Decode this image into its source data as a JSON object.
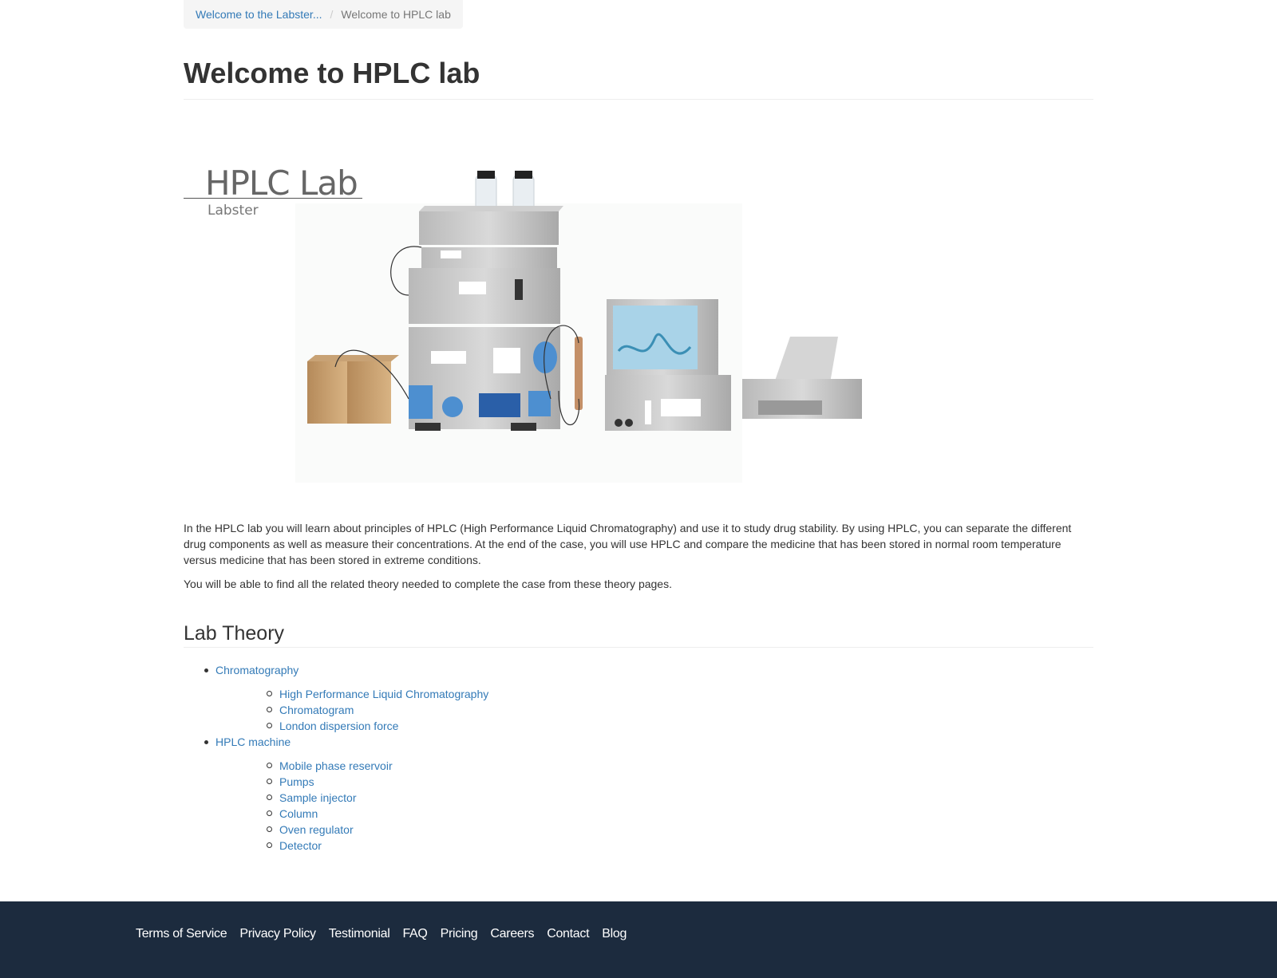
{
  "breadcrumb": {
    "items": [
      {
        "label": "Welcome to the Labster..."
      },
      {
        "label": "Welcome to HPLC lab"
      }
    ],
    "separator": "/"
  },
  "page": {
    "title": "Welcome to HPLC lab"
  },
  "hero": {
    "title": "HPLC Lab",
    "subtitle": "Labster"
  },
  "intro": {
    "paragraphs": [
      "In the HPLC lab you will learn about principles of HPLC (High Performance Liquid Chromatography) and use it to study drug stability. By using HPLC, you can separate the different drug components as well as measure their concentrations. At the end of the case, you will use HPLC and compare the medicine that has been stored in normal room temperature versus medicine that has been stored in extreme conditions.",
      "You will be able to find all the related theory needed to complete the case from these theory pages."
    ]
  },
  "theory": {
    "title": "Lab Theory",
    "items": [
      {
        "label": "Chromatography",
        "children": [
          {
            "label": "High Performance Liquid Chromatography"
          },
          {
            "label": "Chromatogram"
          },
          {
            "label": "London dispersion force"
          }
        ]
      },
      {
        "label": "HPLC machine",
        "children": [
          {
            "label": "Mobile phase reservoir"
          },
          {
            "label": "Pumps"
          },
          {
            "label": "Sample injector"
          },
          {
            "label": "Column"
          },
          {
            "label": "Oven regulator"
          },
          {
            "label": "Detector"
          }
        ]
      }
    ]
  },
  "footer": {
    "links": [
      "Terms of Service",
      "Privacy Policy",
      "Testimonial",
      "FAQ",
      "Pricing",
      "Careers",
      "Contact",
      "Blog"
    ]
  },
  "colors": {
    "link": "#337ab7",
    "footer_bg": "#1c2b3e",
    "text": "#333333"
  }
}
